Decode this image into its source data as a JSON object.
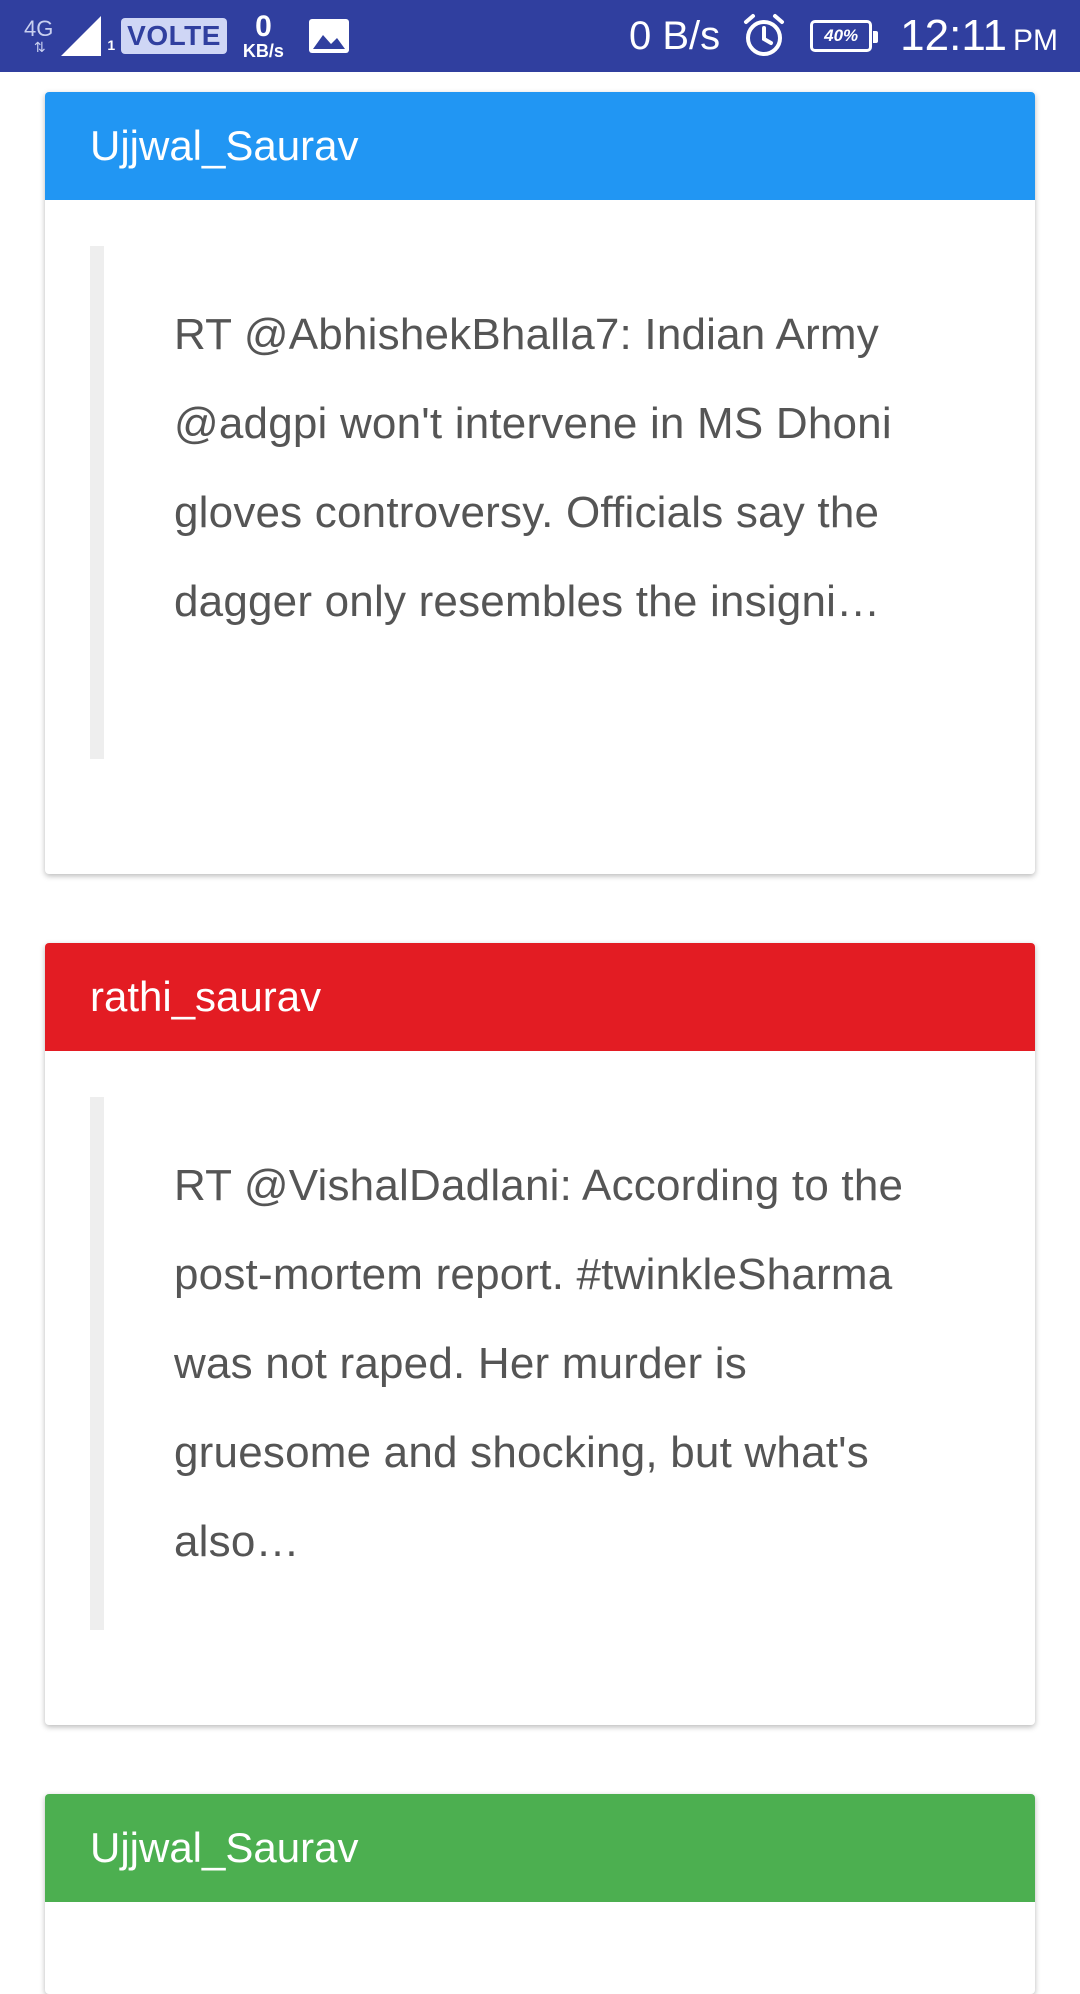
{
  "status_bar": {
    "network": "4G",
    "network_arrows": "⇅",
    "sim_slot": "1",
    "volte": "VOLTE",
    "speed_value": "0",
    "speed_unit": "KB/s",
    "data_rate": "0 B/s",
    "battery": "40%",
    "time": "12:11",
    "ampm": "PM",
    "icons": [
      "signal-icon",
      "gallery-icon",
      "alarm-icon",
      "battery-icon"
    ]
  },
  "cards": [
    {
      "username": "Ujjwal_Saurav",
      "header_color": "#2196f3",
      "text": "RT @AbhishekBhalla7: Indian Army @adgpi won't intervene in MS Dhoni gloves controversy. Officials say the dagger only resembles the insigni…"
    },
    {
      "username": "rathi_saurav",
      "header_color": "#e31c23",
      "text": "RT @VishalDadlani: According to the post-mortem report. #twinkleSharma was not raped. Her murder is gruesome and shocking, but what's also…"
    },
    {
      "username": "Ujjwal_Saurav",
      "header_color": "#4caf50",
      "text": ""
    }
  ]
}
